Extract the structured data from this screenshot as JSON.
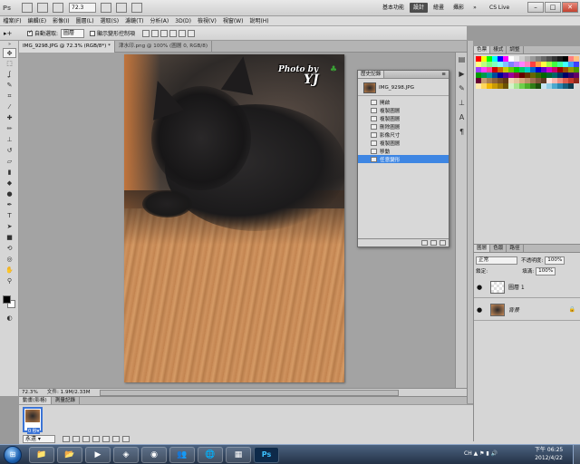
{
  "menubar": {
    "app_logo": "Ps",
    "zoom": "72.3",
    "workspaces": [
      "基本功能",
      "設計",
      "繪畫",
      "攝影"
    ],
    "active_workspace": "設計",
    "more": "»",
    "cs_live": "CS Live",
    "window_buttons": [
      "–",
      "□",
      "✕"
    ]
  },
  "menus": [
    "檔案(F)",
    "編輯(E)",
    "影像(I)",
    "圖層(L)",
    "選取(S)",
    "濾鏡(T)",
    "分析(A)",
    "3D(D)",
    "檢視(V)",
    "視窗(W)",
    "說明(H)"
  ],
  "options": {
    "tool_glyph": "▸+",
    "auto_select_label": "自動選取:",
    "auto_select_value": "圖層",
    "show_transform_label": "顯示變形控制項"
  },
  "tabs": [
    {
      "label": "IMG_9298.JPG @ 72.3% (RGB/8*) *"
    },
    {
      "label": "津水印.png @ 100% (圖層 0, RGB/8)"
    }
  ],
  "watermark": {
    "line1": "Photo by",
    "line2": "YJ",
    "clover": "♣"
  },
  "status": {
    "zoom": "72.3%",
    "doc": "文件: 1.9M/2.33M"
  },
  "history": {
    "tab": "歷史記錄",
    "menu": "≡",
    "snapshot": "IMG_9298.JPG",
    "items": [
      "開啟",
      "複製圖層",
      "複製圖層",
      "刪除圖層",
      "影像尺寸",
      "複製圖層",
      "移動",
      "任意變形"
    ],
    "active_index": 7
  },
  "swatches_panel": {
    "tabs": [
      "色票",
      "樣式",
      "調整"
    ],
    "colors": [
      "#ff0000",
      "#ffff00",
      "#00ff00",
      "#00ffff",
      "#0000ff",
      "#ff00ff",
      "#ffffff",
      "#e6e6e6",
      "#cccccc",
      "#b3b3b3",
      "#999999",
      "#808080",
      "#666666",
      "#4d4d4d",
      "#333333",
      "#1a1a1a",
      "#000000",
      "#ff8080",
      "#ffbf80",
      "#ffff80",
      "#bfff80",
      "#80ff80",
      "#80ffbf",
      "#80ffff",
      "#80bfff",
      "#8080ff",
      "#bf80ff",
      "#ff80ff",
      "#ff80bf",
      "#ff4040",
      "#ff9f40",
      "#ffff40",
      "#9fff40",
      "#40ff40",
      "#40ff9f",
      "#40ffff",
      "#409fff",
      "#4040ff",
      "#9f40ff",
      "#ff40ff",
      "#ff409f",
      "#cc0000",
      "#cc6600",
      "#cccc00",
      "#66cc00",
      "#00cc00",
      "#00cc66",
      "#00cccc",
      "#0066cc",
      "#0000cc",
      "#6600cc",
      "#cc00cc",
      "#cc0066",
      "#990000",
      "#994c00",
      "#999900",
      "#4c9900",
      "#009900",
      "#00994c",
      "#009999",
      "#004c99",
      "#000099",
      "#4c0099",
      "#990099",
      "#99004c",
      "#660000",
      "#663300",
      "#666600",
      "#336600",
      "#006600",
      "#006633",
      "#006666",
      "#003366",
      "#000066",
      "#330066",
      "#660066",
      "#660033",
      "#c69c6d",
      "#a67c52",
      "#8c6239",
      "#754c24",
      "#603813",
      "#f2d7b6",
      "#e8c39e",
      "#d9a87c",
      "#bf8f6a",
      "#9e6f4e",
      "#7f5239",
      "#5e3a24",
      "#fde0dc",
      "#f9b8b0",
      "#f28b7f",
      "#e05c4d",
      "#c63b2c",
      "#8f261b",
      "#ffe9a8",
      "#ffd65c",
      "#f2b705",
      "#c99a04",
      "#a17b03",
      "#6b5202",
      "#d4f2c8",
      "#a8e691",
      "#6fcf4c",
      "#4caf2a",
      "#2f7d18",
      "#1c4f0e",
      "#c8e6f2",
      "#91cfe6",
      "#4ca9cf",
      "#2a86af",
      "#185e7d",
      "#0e3b4f"
    ]
  },
  "layers_panel": {
    "tabs": [
      "圖層",
      "色版",
      "路徑"
    ],
    "blend_mode": "正常",
    "opacity_label": "不透明度:",
    "opacity": "100%",
    "lock_label": "鎖定:",
    "fill_label": "填滿:",
    "fill": "100%",
    "layers": [
      {
        "name": "圖層 1",
        "eye": "●",
        "lock": ""
      },
      {
        "name": "背景",
        "eye": "●",
        "lock": "🔒"
      }
    ]
  },
  "animation": {
    "tabs": [
      "動畫(影格)",
      "測量記錄"
    ],
    "frame_number": "1",
    "frame_duration": "0 秒▾",
    "loop": "永遠 ▾"
  },
  "taskbar": {
    "start": "⊞",
    "apps": [
      "📁",
      "📂",
      "▶",
      "◈",
      "◉",
      "👥",
      "🌐",
      "▦",
      "Ps"
    ],
    "tray": "CH ▲ ⚑ ▮ 🔊",
    "time": "下午 06:25",
    "date": "2012/4/22"
  }
}
